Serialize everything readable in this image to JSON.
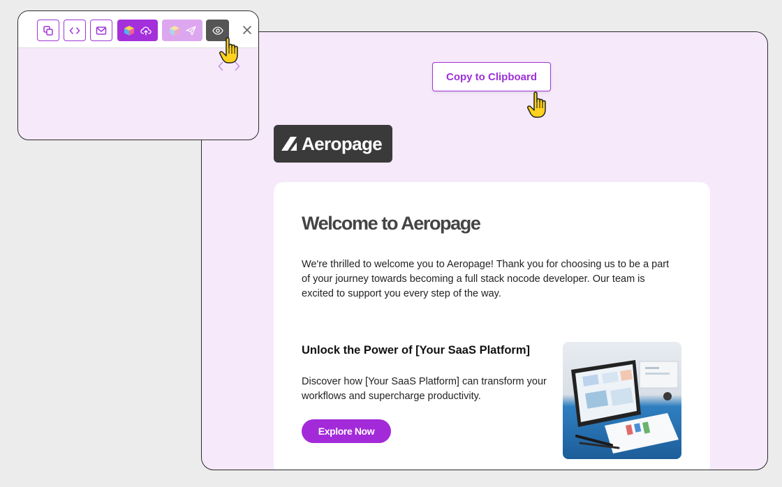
{
  "preview": {
    "copy_button_label": "Copy to Clipboard",
    "logo_text": "Aeropage",
    "email": {
      "title": "Welcome to Aeropage",
      "intro": "We're thrilled to welcome you to Aeropage! Thank you for choosing us to be a part of your journey towards becoming a full stack nocode developer. Our team is excited to support you every step of the way.",
      "feature_heading": "Unlock the Power of [Your SaaS Platform]",
      "feature_text": "Discover how [Your SaaS Platform] can transform your workflows and supercharge productivity.",
      "cta_label": "Explore Now"
    }
  },
  "toolbar": {
    "buttons": [
      {
        "icon": "copy-icon"
      },
      {
        "icon": "code-icon"
      },
      {
        "icon": "mail-icon"
      },
      {
        "icon": "cube-icon",
        "secondary_icon": "cloud-upload-icon",
        "state": "active"
      },
      {
        "icon": "cube-icon",
        "secondary_icon": "send-icon",
        "state": "disabled"
      },
      {
        "icon": "eye-icon",
        "state": "hover"
      },
      {
        "icon": "close-icon"
      }
    ],
    "nav": [
      "chevron-left-icon",
      "chevron-right-icon"
    ]
  },
  "colors": {
    "accent": "#a430dc",
    "panel_background": "#f5e9fa",
    "page_background": "#ececec",
    "logo_background": "#3a3a3a"
  }
}
